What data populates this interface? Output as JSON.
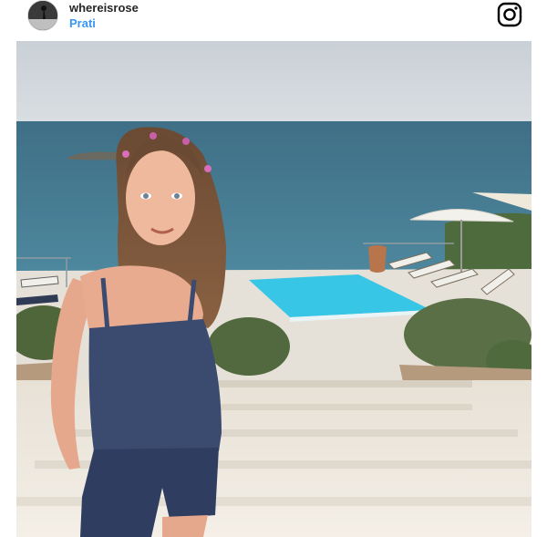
{
  "post": {
    "username": "whereisrose",
    "follow_label": "Prati"
  },
  "icons": {
    "avatar": "profile-avatar",
    "brand": "instagram-icon"
  },
  "colors": {
    "link": "#3897f0",
    "text": "#262626",
    "sea": "#3e7d97",
    "pool": "#3cc8e6",
    "sky": "#cfd6dc"
  }
}
